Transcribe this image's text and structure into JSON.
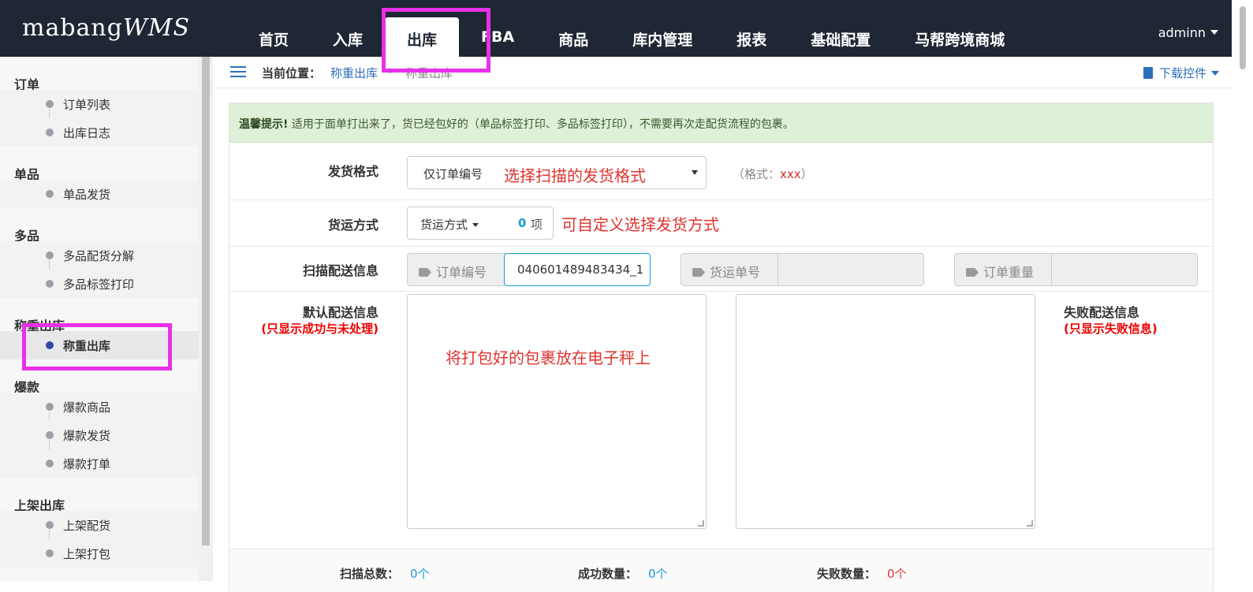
{
  "app": {
    "logo_main": "mabang",
    "logo_suffix": "WMS",
    "user": "adminn"
  },
  "nav": [
    {
      "label": "首页"
    },
    {
      "label": "入库"
    },
    {
      "label": "出库",
      "active": true
    },
    {
      "label": "FBA"
    },
    {
      "label": "商品"
    },
    {
      "label": "库内管理"
    },
    {
      "label": "报表"
    },
    {
      "label": "基础配置"
    },
    {
      "label": "马帮跨境商城"
    }
  ],
  "sidebar": {
    "g_order": "订单",
    "i_order_list": "订单列表",
    "i_out_log": "出库日志",
    "g_single": "单品",
    "i_single_ship": "单品发货",
    "g_multi": "多品",
    "i_multi_split": "多品配货分解",
    "i_multi_label": "多品标签打印",
    "g_weigh": "称重出库",
    "i_weigh": "称重出库",
    "g_hot": "爆款",
    "i_hot_goods": "爆款商品",
    "i_hot_ship": "爆款发货",
    "i_hot_print": "爆款打单",
    "g_shelf": "上架出库",
    "i_shelf_pick": "上架配货",
    "i_shelf_pack": "上架打包"
  },
  "breadcrumb": {
    "label": "当前位置：",
    "link": "称重出库",
    "sep": ">",
    "current": "称重出库",
    "download": "下载控件"
  },
  "alert": {
    "title": "温馨提示!",
    "text": " 适用于面单打出来了，货已经包好的（单品标签打印、多品标签打印），不需要再次走配货流程的包裹。"
  },
  "form": {
    "format_label": "发货格式",
    "format_value": "仅订单编号",
    "format_hint": "选择扫描的发货格式",
    "format_note_prefix": "（格式：",
    "format_note_x": "xxx",
    "format_note_suffix": "）",
    "ship_label": "货运方式",
    "ship_select": "货运方式",
    "ship_count": "0",
    "ship_unit": "项",
    "ship_hint": "可自定义选择发货方式",
    "scan_label": "扫描配送信息",
    "order_no_addon": "订单编号",
    "order_no_value": "040601489483434_1",
    "tracking_addon": "货运单号",
    "weight_addon": "订单重量",
    "default_label": "默认配送信息",
    "default_sub": "(只显示成功与未处理)",
    "textarea_hint": "将打包好的包裹放在电子秤上",
    "fail_label": "失败配送信息",
    "fail_sub": "(只显示失败信息)"
  },
  "stats": {
    "total_label": "扫描总数：",
    "total": "0个",
    "success_label": "成功数量：",
    "success": "0个",
    "fail_label": "失败数量：",
    "fail": "0个"
  },
  "colors": {
    "nav_bg": "#1f2734",
    "highlight": "#e830e8",
    "link": "#2d6fb7",
    "hint_red": "#e0342f"
  }
}
